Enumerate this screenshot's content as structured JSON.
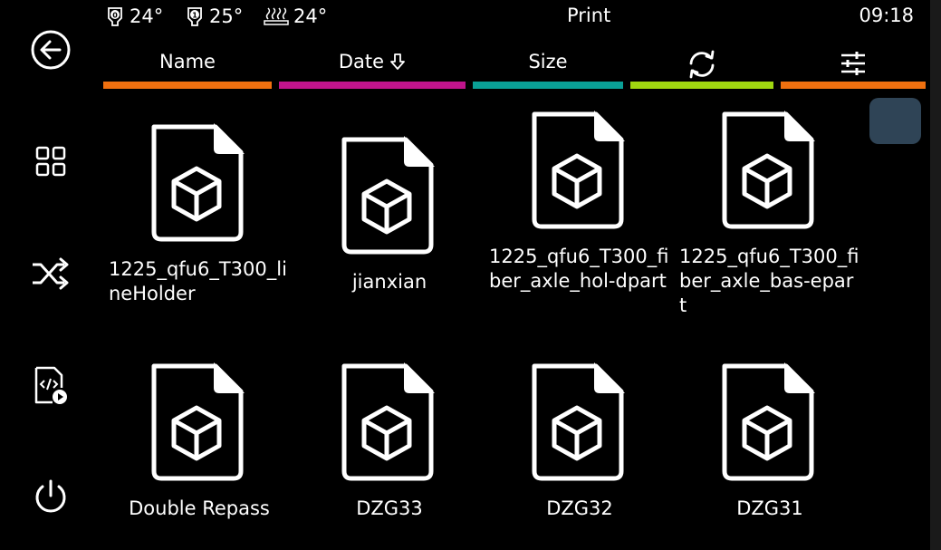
{
  "status": {
    "title": "Print",
    "time": "09:18",
    "temps": [
      {
        "icon": "extruder-0-icon",
        "value": "24°"
      },
      {
        "icon": "extruder-1-icon",
        "value": "25°"
      },
      {
        "icon": "heated-bed-icon",
        "value": "24°"
      }
    ]
  },
  "sidebar": {
    "items": [
      {
        "icon": "back-arrow-icon"
      },
      {
        "icon": "grid-menu-icon"
      },
      {
        "icon": "shuffle-icon"
      },
      {
        "icon": "gcode-file-icon"
      },
      {
        "icon": "power-icon"
      }
    ]
  },
  "tabs": [
    {
      "label": "Name",
      "color": "#f0700f"
    },
    {
      "label": "Date",
      "color": "#c0148c",
      "sort_icon": "sort-down-arrow-icon"
    },
    {
      "label": "Size",
      "color": "#0aa096"
    },
    {
      "icon": "refresh-icon",
      "color": "#a0d810"
    },
    {
      "icon": "filter-sliders-icon",
      "color": "#f0700f"
    }
  ],
  "files": [
    {
      "name": "1225_qfu6_T300_lineHolder"
    },
    {
      "name": "jianxian"
    },
    {
      "name": "1225_qfu6_T300_fiber_axle_hol-dpart"
    },
    {
      "name": "1225_qfu6_T300_fiber_axle_bas-epart"
    },
    {
      "name": "Double Repass"
    },
    {
      "name": "DZG33"
    },
    {
      "name": "DZG32"
    },
    {
      "name": "DZG31"
    }
  ],
  "colors": {
    "background": "#000000",
    "scroll_thumb": "#2f4456"
  }
}
